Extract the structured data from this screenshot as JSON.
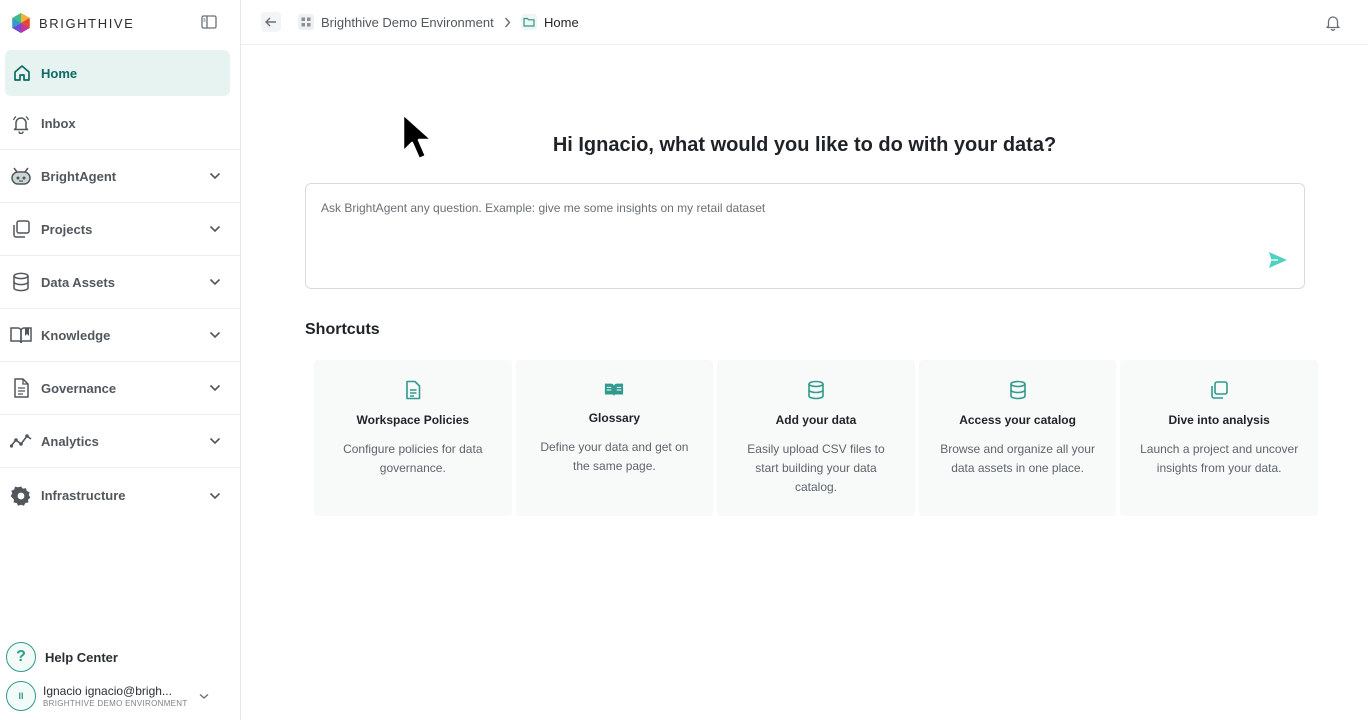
{
  "brand": {
    "name": "BRIGHTHIVE"
  },
  "sidebar": {
    "items": [
      {
        "label": "Home",
        "icon": "home-icon"
      },
      {
        "label": "Inbox",
        "icon": "bell-icon"
      },
      {
        "label": "BrightAgent",
        "icon": "robot-icon"
      },
      {
        "label": "Projects",
        "icon": "projects-icon"
      },
      {
        "label": "Data Assets",
        "icon": "database-icon"
      },
      {
        "label": "Knowledge",
        "icon": "book-icon"
      },
      {
        "label": "Governance",
        "icon": "document-icon"
      },
      {
        "label": "Analytics",
        "icon": "analytics-icon"
      },
      {
        "label": "Infrastructure",
        "icon": "gear-icon"
      }
    ],
    "help": {
      "label": "Help Center",
      "icon_text": "?"
    },
    "user": {
      "initials": "II",
      "name": "Ignacio ignacio@brigh...",
      "environment": "BRIGHTHIVE DEMO ENVIRONMENT"
    }
  },
  "breadcrumb": {
    "workspace": "Brighthive Demo Environment",
    "current": "Home"
  },
  "main": {
    "greeting": "Hi Ignacio, what would you like to do with your data?",
    "ask_placeholder": "Ask BrightAgent any question. Example: give me some insights on my retail dataset",
    "shortcuts_title": "Shortcuts",
    "shortcuts": [
      {
        "title": "Workspace Policies",
        "description": "Configure policies for data governance.",
        "icon": "document-icon"
      },
      {
        "title": "Glossary",
        "description": "Define your data and get on the same page.",
        "icon": "open-book-icon"
      },
      {
        "title": "Add your data",
        "description": "Easily upload CSV files to start building your data catalog.",
        "icon": "database-icon"
      },
      {
        "title": "Access your catalog",
        "description": "Browse and organize all your data assets in one place.",
        "icon": "database-icon"
      },
      {
        "title": "Dive into analysis",
        "description": "Launch a project and uncover insights from your data.",
        "icon": "projects-icon"
      }
    ]
  },
  "colors": {
    "accent": "#2f9a8d",
    "accent_dark": "#0d6b63",
    "active_bg": "#e7f3f1",
    "send": "#4fd1c0"
  }
}
